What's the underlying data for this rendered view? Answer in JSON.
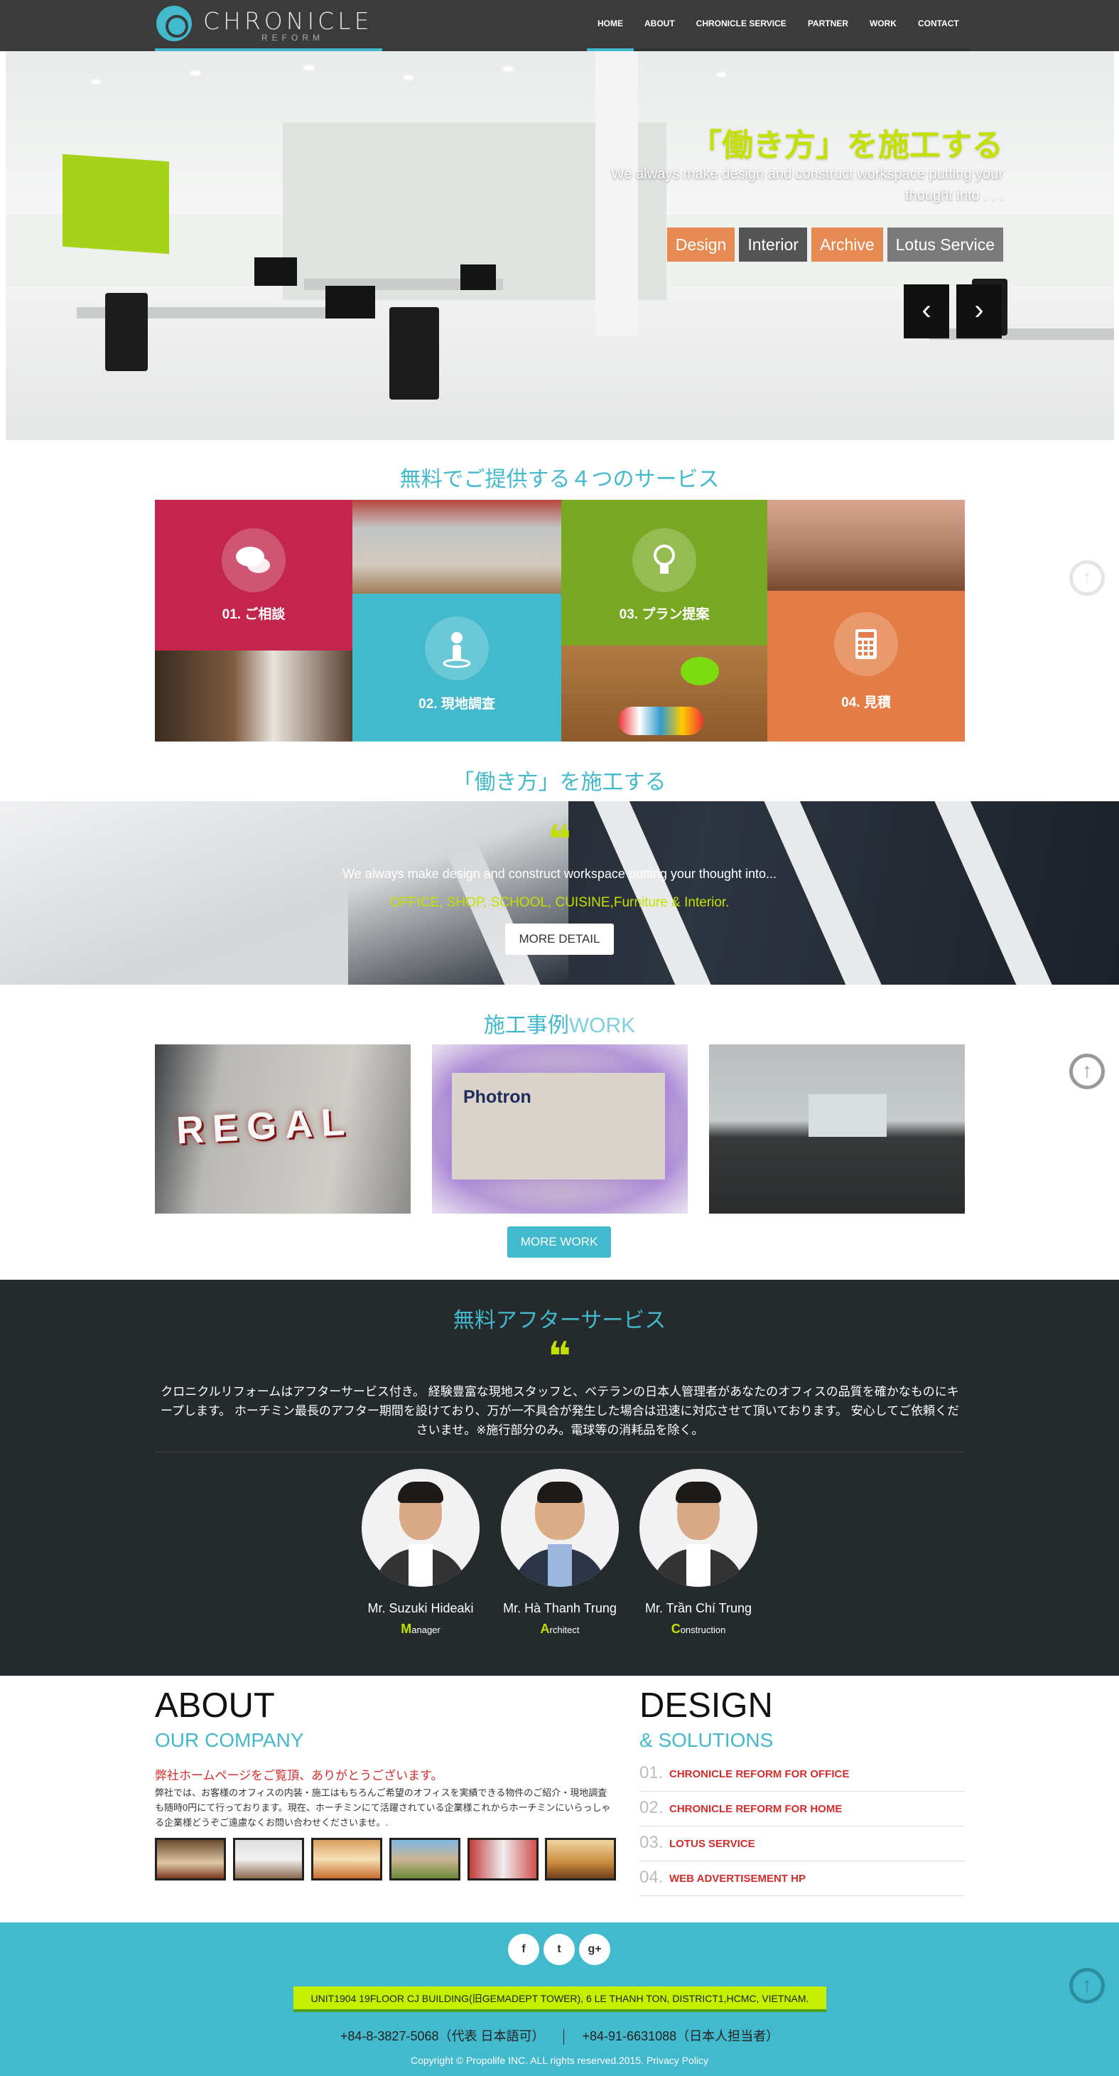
{
  "header": {
    "logo_name": "CHRONICLE",
    "logo_sub": "REFORM",
    "nav": [
      "HOME",
      "ABOUT",
      "CHRONICLE SERVICE",
      "PARTNER",
      "WORK",
      "CONTACT"
    ],
    "active_nav": "HOME"
  },
  "hero": {
    "title": "「働き方」を施工する",
    "text": "We always make design and construct workspace putting your thought into . . .",
    "tags": [
      {
        "label": "Design",
        "color": "#e48a52"
      },
      {
        "label": "Interior",
        "color": "#555555"
      },
      {
        "label": "Archive",
        "color": "#e48a52"
      },
      {
        "label": "Lotus Service",
        "color": "#7a7a7a"
      }
    ],
    "prev_icon": "chevron-left-icon",
    "next_icon": "chevron-right-icon"
  },
  "services": {
    "heading": "無料でご提供する４つのサービス",
    "items": [
      {
        "label": "01. ご相談",
        "icon": "chat-bubbles-icon",
        "color": "#c3254d"
      },
      {
        "label": "02. 現地調査",
        "icon": "person-pin-icon",
        "color": "#42b9cc"
      },
      {
        "label": "03. プラン提案",
        "icon": "lightbulb-icon",
        "color": "#78a823"
      },
      {
        "label": "04. 見積",
        "icon": "calculator-icon",
        "color": "#e47d45"
      }
    ]
  },
  "concept": {
    "heading": "「働き方」を施工する",
    "quote_mark": "❝",
    "text": "We always make design and construct workspace putting your thought into...",
    "highlight": "OFFICE, SHOP, SCHOOL, CUISINE,Furniture & Interior.",
    "button": "MORE DETAIL"
  },
  "work": {
    "heading_jp": "施工事例",
    "heading_en": "WORK",
    "images": [
      "REGAL",
      "Photron",
      ""
    ],
    "button": "MORE WORK"
  },
  "after_service": {
    "heading": "無料アフターサービス",
    "quote_mark": "❝",
    "body": "クロニクルリフォームはアフターサービス付き。 経験豊富な現地スタッフと、ベテランの日本人管理者があなたのオフィスの品質を確かなものにキープします。 ホーチミン最長のアフター期間を設けており、万が一不具合が発生した場合は迅速に対応させて頂いております。 安心してご依頼くださいませ。※施行部分のみ。電球等の消耗品を除く。",
    "members": [
      {
        "name": "Mr. Suzuki Hideaki",
        "role_initial": "M",
        "role_rest": "anager"
      },
      {
        "name": "Mr. Hà Thanh Trung",
        "role_initial": "A",
        "role_rest": "rchitect"
      },
      {
        "name": "Mr. Trần Chí Trung",
        "role_initial": "C",
        "role_rest": "onstruction"
      }
    ]
  },
  "about": {
    "heading": "ABOUT",
    "subheading": "OUR COMPANY",
    "lead": "弊社ホームページをご覧頂、ありがとうございます。",
    "text": "弊社では、お客様のオフィスの内装・施工はもちろんご希望のオフィスを実績できる物件のご紹介・現地調査も随時0円にて行っております。現在、ホーチミンにて活躍されている企業様これからホーチミンにいらっしゃる企業様どうぞご遠慮なくお問い合わせくださいませ。."
  },
  "design": {
    "heading": "DESIGN",
    "subheading": "& SOLUTIONS",
    "items": [
      {
        "num": "01.",
        "label": "CHRONICLE REFORM FOR OFFICE"
      },
      {
        "num": "02.",
        "label": "CHRONICLE REFORM FOR HOME"
      },
      {
        "num": "03.",
        "label": "LOTUS SERVICE"
      },
      {
        "num": "04.",
        "label": "WEB ADVERTISEMENT HP"
      }
    ]
  },
  "footer": {
    "social": [
      "f",
      "t",
      "g+"
    ],
    "address": "UNIT1904 19FLOOR CJ BUILDING(旧GEMADEPT TOWER), 6 LE THANH TON, DISTRICT1,HCMC, VIETNAM.",
    "tel_1": "+84-8-3827-5068（代表 日本語可）",
    "tel_2": "+84-91-6631088（日本人担当者）",
    "copyright": "Copyright © Propolife INC. ALL rights reserved.2015. Privacy Policy"
  },
  "back_to_top_icon": "arrow-up-circle-icon",
  "colors": {
    "accent": "#42b9cc",
    "lime": "#c4e000",
    "dark": "#252a2d",
    "red": "#d32c2c"
  }
}
